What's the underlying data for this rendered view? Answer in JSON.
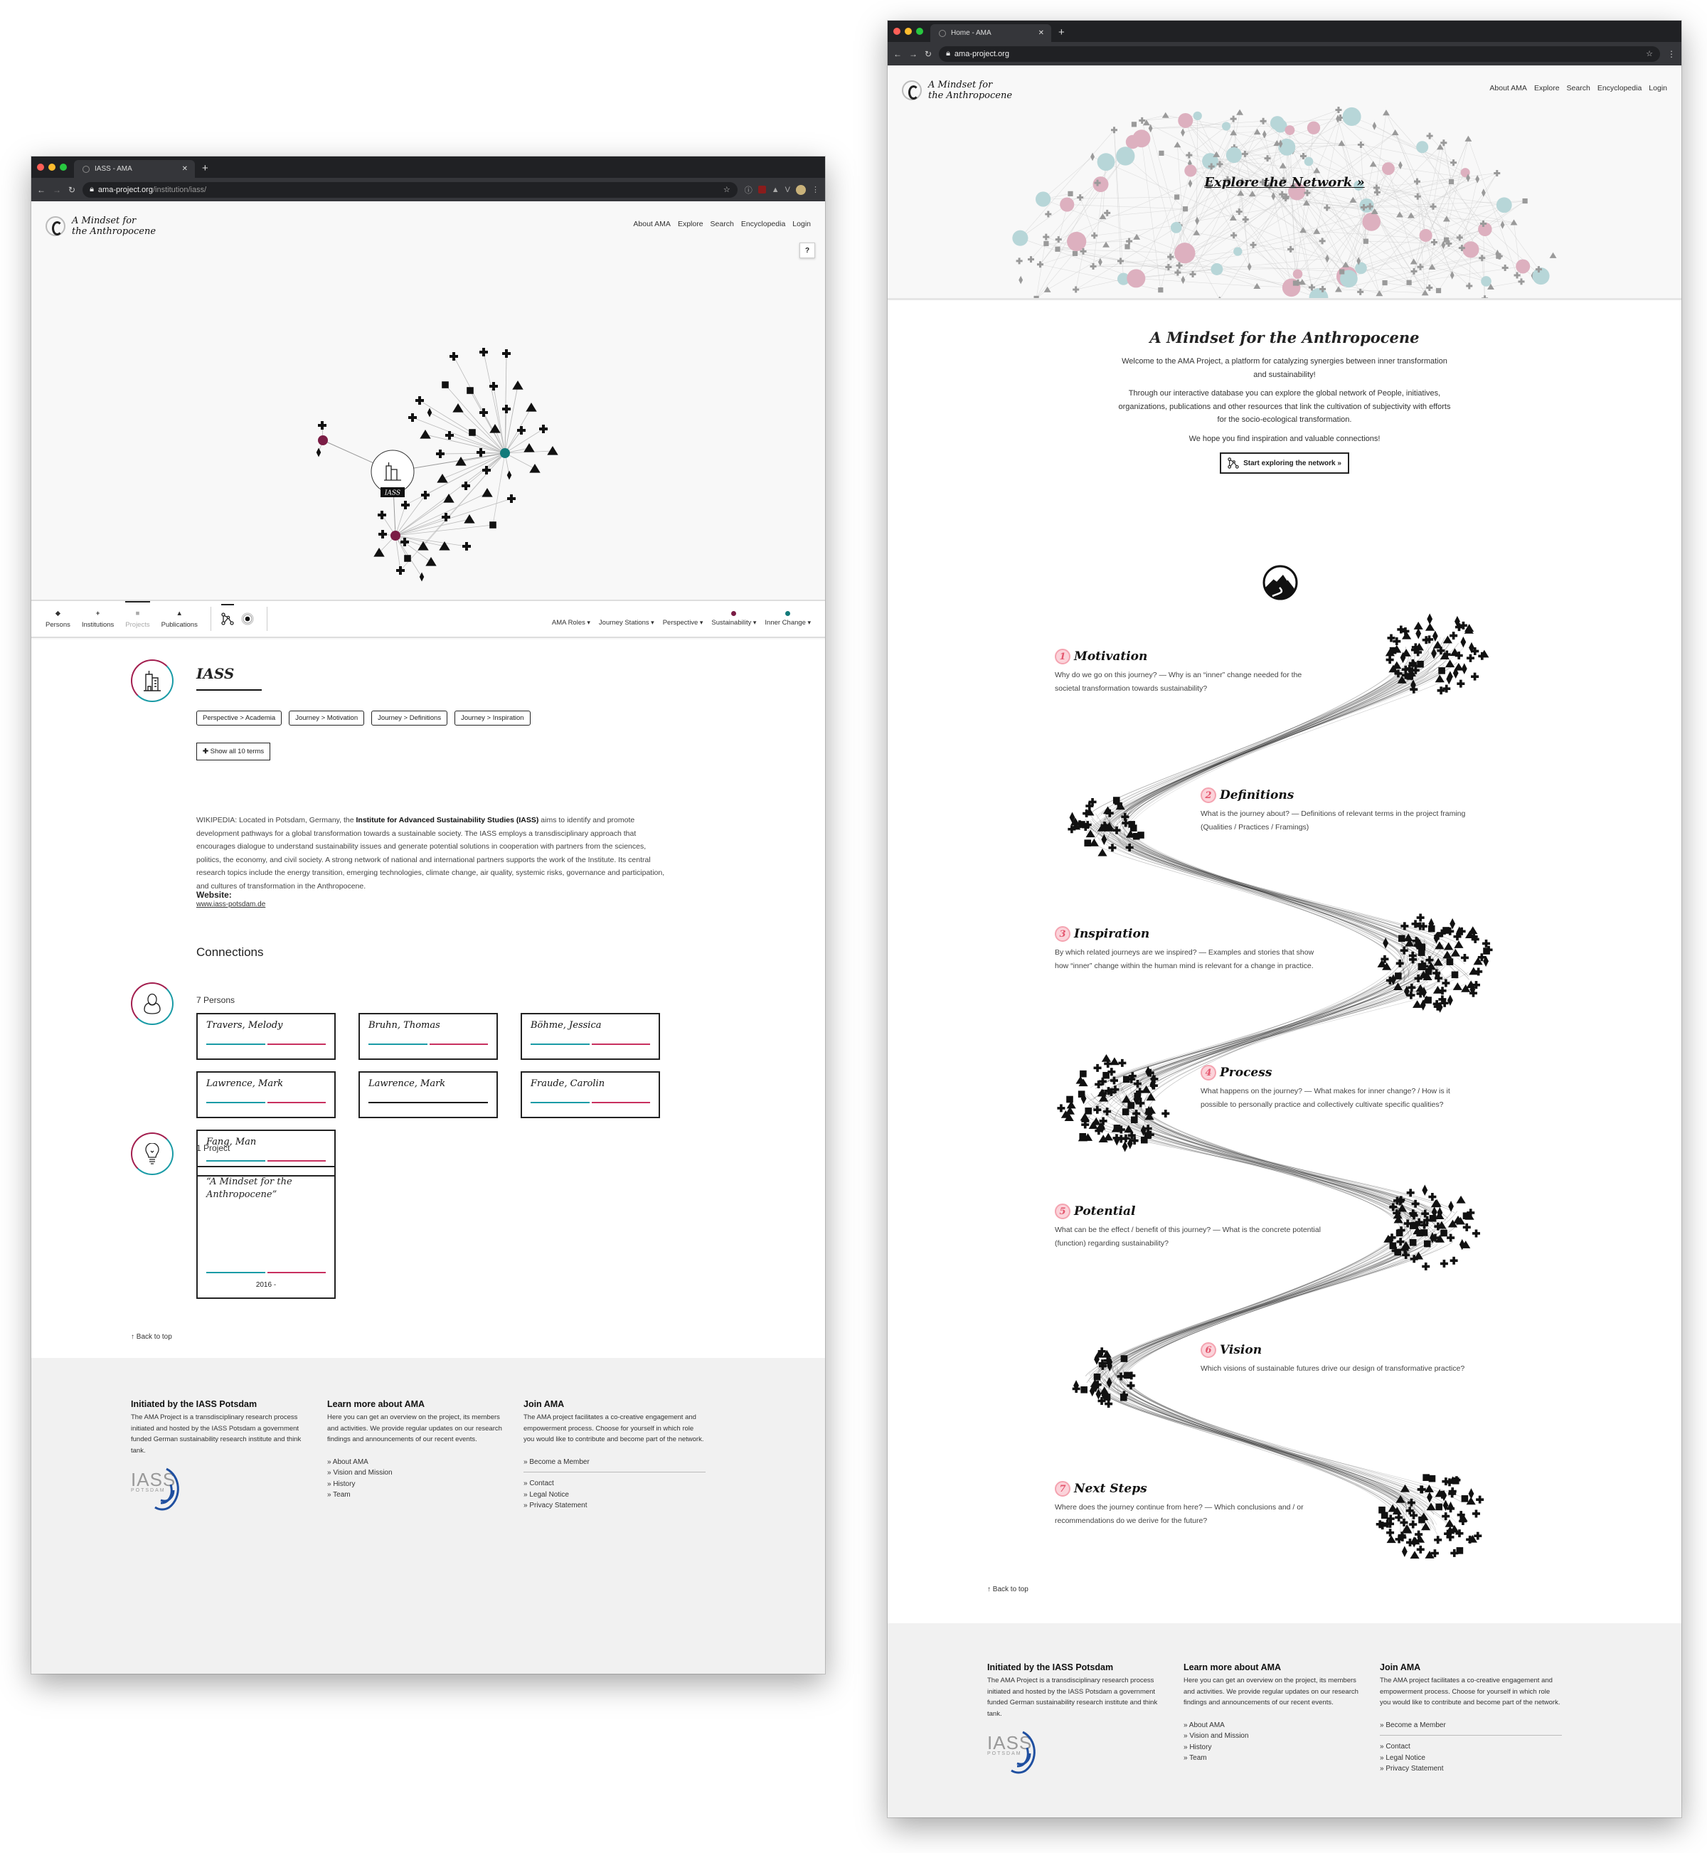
{
  "colors": {
    "sustainability": "#7a1c45",
    "inner_change": "#137a7a",
    "teal_bar": "#1a9ba6",
    "crimson_bar": "#c8305f",
    "station_pink": "#e4566e"
  },
  "window1": {
    "tab_title": "IASS - AMA",
    "url_host": "ama-project.org",
    "url_path": "/institution/iass/",
    "site": {
      "logo_line1": "A Mindset for",
      "logo_line2": "the Anthropocene",
      "nav": [
        "About AMA",
        "Explore",
        "Search",
        "Encyclopedia",
        "Login"
      ],
      "help_label": "?"
    },
    "graph": {
      "center_label": "IASS",
      "center_icon": "building-icon"
    },
    "filterbar": {
      "types": [
        {
          "label": "Persons",
          "icon": "diamond-icon",
          "state": "normal"
        },
        {
          "label": "Institutions",
          "icon": "plus-icon",
          "state": "normal"
        },
        {
          "label": "Projects",
          "icon": "square-icon",
          "state": "dimmed"
        },
        {
          "label": "Publications",
          "icon": "triangle-icon",
          "state": "normal"
        }
      ],
      "view_modes": [
        "network-view-icon",
        "focus-view-icon"
      ],
      "dropdowns": [
        {
          "label": "AMA Roles"
        },
        {
          "label": "Journey Stations"
        },
        {
          "label": "Perspective"
        },
        {
          "label": "Sustainability",
          "dot": "#7a1c45"
        },
        {
          "label": "Inner Change",
          "dot": "#137a7a"
        }
      ]
    },
    "entity": {
      "title": "IASS",
      "tags": [
        "Perspective > Academia",
        "Journey > Motivation",
        "Journey > Definitions",
        "Journey > Inspiration"
      ],
      "show_all": "Show all 10 terms",
      "description_prefix": "WIKIPEDIA: Located in Potsdam, Germany, the ",
      "description_bold": "Institute for Advanced Sustainability Studies (IASS)",
      "description_rest": " aims to identify and promote development pathways for a global transformation towards a sustainable society. The IASS employs a transdisciplinary approach that encourages dialogue to understand sustainability issues and generate potential solutions in cooperation with partners from the sciences, politics, the economy, and civil society. A strong network of national and international partners supports the work of the Institute. Its central research topics include the energy transition, emerging technologies, climate change, air quality, systemic risks, governance and participation, and cultures of transformation in the Anthropocene.",
      "website_label": "Website:",
      "website_value": "www.iass-potsdam.de"
    },
    "connections": {
      "heading": "Connections",
      "persons_count": "7 Persons",
      "persons": [
        {
          "name": "Travers, Melody",
          "bars": "split"
        },
        {
          "name": "Bruhn, Thomas",
          "bars": "split"
        },
        {
          "name": "Böhme, Jessica",
          "bars": "split"
        },
        {
          "name": "Lawrence, Mark",
          "bars": "split"
        },
        {
          "name": "Lawrence, Mark",
          "bars": "black"
        },
        {
          "name": "Fraude, Carolin",
          "bars": "split"
        },
        {
          "name": "Fang, Man",
          "bars": "split"
        }
      ],
      "projects_count": "1 Project",
      "projects": [
        {
          "name": "“A Mindset for the Anthropocene”",
          "years": "2016 -"
        }
      ]
    },
    "back_to_top": "↑ Back to top"
  },
  "footer": {
    "col1": {
      "title": "Initiated by the IASS Potsdam",
      "text": "The AMA Project is a transdisciplinary research process initiated and hosted by the IASS Potsdam a government funded German sustainability research institute and think tank.",
      "logo_main": "IASS",
      "logo_sub": "POTSDAM"
    },
    "col2": {
      "title": "Learn more about AMA",
      "text": "Here you can get an overview on the project, its members and activities. We provide regular updates on our research findings and announcements of our recent events.",
      "links": [
        "» About AMA",
        "» Vision and Mission",
        "» History",
        "» Team"
      ]
    },
    "col3": {
      "title": "Join AMA",
      "text": "The AMA project facilitates a co-creative engagement and empowerment process. Choose for yourself in which role you would like to contribute and become part of the network.",
      "primary_link": "» Become a Member",
      "links": [
        "» Contact",
        "» Legal Notice",
        "» Privacy Statement"
      ]
    }
  },
  "window2": {
    "tab_title": "Home - AMA",
    "url_host": "ama-project.org",
    "hero_link": "Explore the Network »",
    "intro": {
      "title": "A Mindset for the Anthropocene",
      "p1": "Welcome to the AMA Project, a platform for catalyzing synergies between inner transformation and sustainability!",
      "p2": "Through our interactive database you can explore the global network of People, initiatives, organizations, publications and other resources that link the cultivation of subjectivity with efforts for the socio-ecological transformation.",
      "p3": "We hope you find inspiration and valuable connections!",
      "button": "Start exploring the network »"
    },
    "stations": [
      {
        "num": "1",
        "title": "Motivation",
        "text": "Why do we go on this journey? — Why is an “inner” change needed for the societal transformation towards sustainability?"
      },
      {
        "num": "2",
        "title": "Definitions",
        "text": "What is the journey about? — Definitions of relevant terms in the project framing (Qualities / Practices / Framings)"
      },
      {
        "num": "3",
        "title": "Inspiration",
        "text": "By which related journeys are we inspired? — Examples and stories that show how “inner” change within the human mind is relevant for a change in practice."
      },
      {
        "num": "4",
        "title": "Process",
        "text": "What happens on the journey? — What makes for inner change? / How is it possible to personally practice and collectively cultivate specific qualities?"
      },
      {
        "num": "5",
        "title": "Potential",
        "text": "What can be the effect / benefit of this journey? — What is the concrete potential (function) regarding sustainability?"
      },
      {
        "num": "6",
        "title": "Vision",
        "text": "Which visions of sustainable futures drive our design of transformative practice?"
      },
      {
        "num": "7",
        "title": "Next Steps",
        "text": "Where does the journey continue from here? — Which conclusions and / or recommendations do we derive for the future?"
      }
    ],
    "back_to_top": "↑ Back to top"
  }
}
